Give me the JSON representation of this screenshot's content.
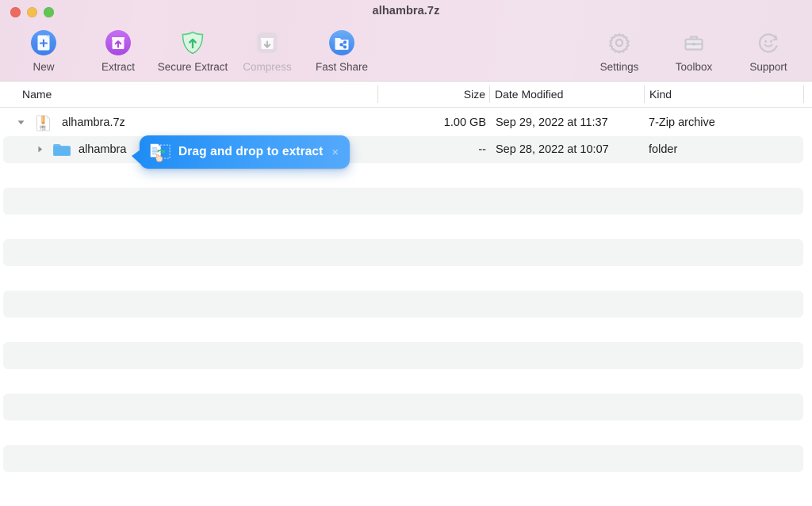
{
  "window": {
    "title": "alhambra.7z",
    "traffic_lights": [
      {
        "name": "close",
        "color": "#ec6a5f"
      },
      {
        "name": "minimize",
        "color": "#f4bd4f"
      },
      {
        "name": "maximize",
        "color": "#61c554"
      }
    ]
  },
  "toolbar": {
    "left_items": [
      {
        "label": "New",
        "icon": "new-archive-icon",
        "state": "enabled",
        "accent": "#4a90f0"
      },
      {
        "label": "Extract",
        "icon": "extract-icon",
        "state": "enabled",
        "accent": "#b95bee"
      },
      {
        "label": "Secure Extract",
        "icon": "secure-extract-icon",
        "state": "enabled",
        "accent": "#4fc878"
      },
      {
        "label": "Compress",
        "icon": "compress-icon",
        "state": "disabled",
        "accent": "#cfcfd4"
      },
      {
        "label": "Fast Share",
        "icon": "fast-share-icon",
        "state": "enabled",
        "accent": "#5aa2f6"
      }
    ],
    "right_items": [
      {
        "label": "Settings",
        "icon": "gear-icon",
        "state": "enabled",
        "accent": "#cdc8cf"
      },
      {
        "label": "Toolbox",
        "icon": "briefcase-icon",
        "state": "enabled",
        "accent": "#cdc8cf"
      },
      {
        "label": "Support",
        "icon": "smiley-icon",
        "state": "enabled",
        "accent": "#cdc8cf"
      }
    ]
  },
  "columns": [
    {
      "key": "name",
      "label": "Name"
    },
    {
      "key": "size",
      "label": "Size"
    },
    {
      "key": "date",
      "label": "Date Modified"
    },
    {
      "key": "kind",
      "label": "Kind"
    }
  ],
  "rows": [
    {
      "name": "alhambra.7z",
      "size": "1.00 GB",
      "date": "Sep 29, 2022 at 11:37",
      "kind": "7-Zip archive",
      "icon": "sevenzip-archive-icon",
      "depth": 0,
      "expanded": true,
      "striped": false
    },
    {
      "name": "alhambra",
      "size": "--",
      "date": "Sep 28, 2022 at 10:07",
      "kind": "folder",
      "icon": "folder-icon",
      "depth": 1,
      "expanded": false,
      "striped": true
    }
  ],
  "empty_stripe_count": 6,
  "tooltip": {
    "text": "Drag and drop to extract",
    "close_label": "×",
    "icon": "drag-drop-extract-icon",
    "gradient_from": "#1f8cf5",
    "gradient_to": "#55a9fb"
  }
}
